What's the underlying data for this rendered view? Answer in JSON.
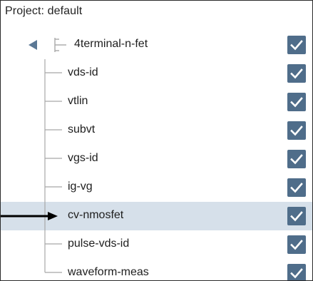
{
  "project": {
    "title": "Project: default"
  },
  "tree": {
    "root": {
      "label": "4terminal-n-fet",
      "icon": "device-tree-icon",
      "expanded": true,
      "checked": true
    },
    "items": [
      {
        "label": "vds-id",
        "checked": true,
        "selected": false
      },
      {
        "label": "vtlin",
        "checked": true,
        "selected": false
      },
      {
        "label": "subvt",
        "checked": true,
        "selected": false
      },
      {
        "label": "vgs-id",
        "checked": true,
        "selected": false
      },
      {
        "label": "ig-vg",
        "checked": true,
        "selected": false
      },
      {
        "label": "cv-nmosfet",
        "checked": true,
        "selected": true
      },
      {
        "label": "pulse-vds-id",
        "checked": true,
        "selected": false
      },
      {
        "label": "waveform-meas",
        "checked": true,
        "selected": false
      }
    ]
  },
  "colors": {
    "checkbox": "#4f6d8a",
    "selection": "#d6e0ea",
    "tree_lines": "#a8a8a8",
    "pointer_arrow": "#000000"
  }
}
